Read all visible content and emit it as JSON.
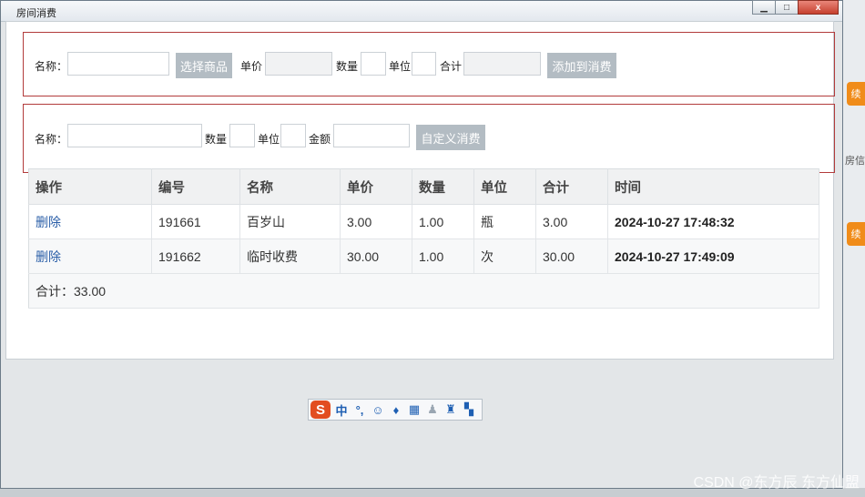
{
  "window": {
    "title": "房间消费",
    "min": "▁",
    "max": "□",
    "close": "x"
  },
  "form1": {
    "name_label": "名称：",
    "select_button": "选择商品",
    "price_label": "单价",
    "qty_label": "数量",
    "unit_label": "单位",
    "total_label": "合计",
    "add_button": "添加到消费"
  },
  "form2": {
    "name_label": "名称：",
    "qty_label": "数量",
    "unit_label": "单位",
    "amount_label": "金额",
    "custom_button": "自定义消费"
  },
  "table": {
    "headers": [
      "操作",
      "编号",
      "名称",
      "单价",
      "数量",
      "单位",
      "合计",
      "时间"
    ],
    "rows": [
      [
        "删除",
        "191661",
        "百岁山",
        "3.00",
        "1.00",
        "瓶",
        "3.00",
        "2024-10-27 17:48:32"
      ],
      [
        "删除",
        "191662",
        "临时收费",
        "30.00",
        "1.00",
        "次",
        "30.00",
        "2024-10-27 17:49:09"
      ]
    ],
    "total": "合计：33.00"
  },
  "ime": {
    "logo": "S",
    "mode": "中",
    "punct": "°,",
    "icons": [
      "smile-icon",
      "mic-icon",
      "keyboard-icon",
      "user-icon",
      "shirt-icon",
      "grid-icon"
    ]
  },
  "background": {
    "right_text1": "续",
    "right_text2": "房信",
    "right_text3": "续"
  },
  "watermark": "CSDN @东方辰     东方仙盟"
}
